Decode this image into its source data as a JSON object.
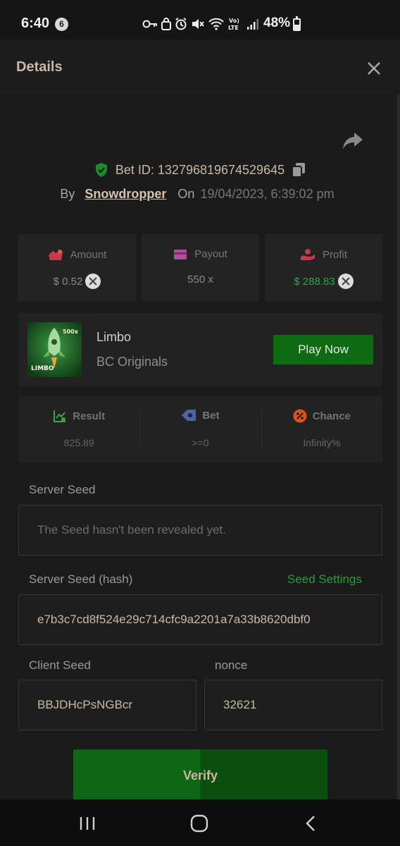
{
  "status_bar": {
    "time": "6:40",
    "notification_count": "6",
    "battery": "48%"
  },
  "header": {
    "title": "Details"
  },
  "bet": {
    "id_text": "Bet ID: 132796819674529645",
    "by_label": "By",
    "user": "Snowdropper",
    "on_label": "On",
    "date": "19/04/2023, 6:39:02 pm"
  },
  "stats": {
    "amount_label": "Amount",
    "amount_value": "$ 0.52",
    "payout_label": "Payout",
    "payout_value": "550 x",
    "profit_label": "Profit",
    "profit_value": "$ 288.83"
  },
  "game": {
    "thumb_badge": "500x",
    "thumb_label": "LIMBO",
    "name": "Limbo",
    "provider": "BC Originals",
    "play_label": "Play Now"
  },
  "result": {
    "result_label": "Result",
    "result_value": "825.89",
    "bet_label": "Bet",
    "bet_value": ">=0",
    "chance_label": "Chance",
    "chance_value": "Infinity%"
  },
  "seeds": {
    "server_seed_label": "Server Seed",
    "server_seed_value": "The Seed hasn't been revealed yet.",
    "server_hash_label": "Server Seed (hash)",
    "seed_settings_label": "Seed Settings",
    "server_hash_value": "e7b3c7cd8f524e29c714cfc9a2201a7a33b8620dbf0",
    "client_seed_label": "Client Seed",
    "client_seed_value": "BBJDHcPsNGBcr",
    "nonce_label": "nonce",
    "nonce_value": "32621"
  },
  "verify_label": "Verify",
  "colors": {
    "accent_green": "#0f6b12",
    "profit_green": "#29a84c",
    "text_tan": "#c9b9a6",
    "background": "#1b1b1b"
  }
}
